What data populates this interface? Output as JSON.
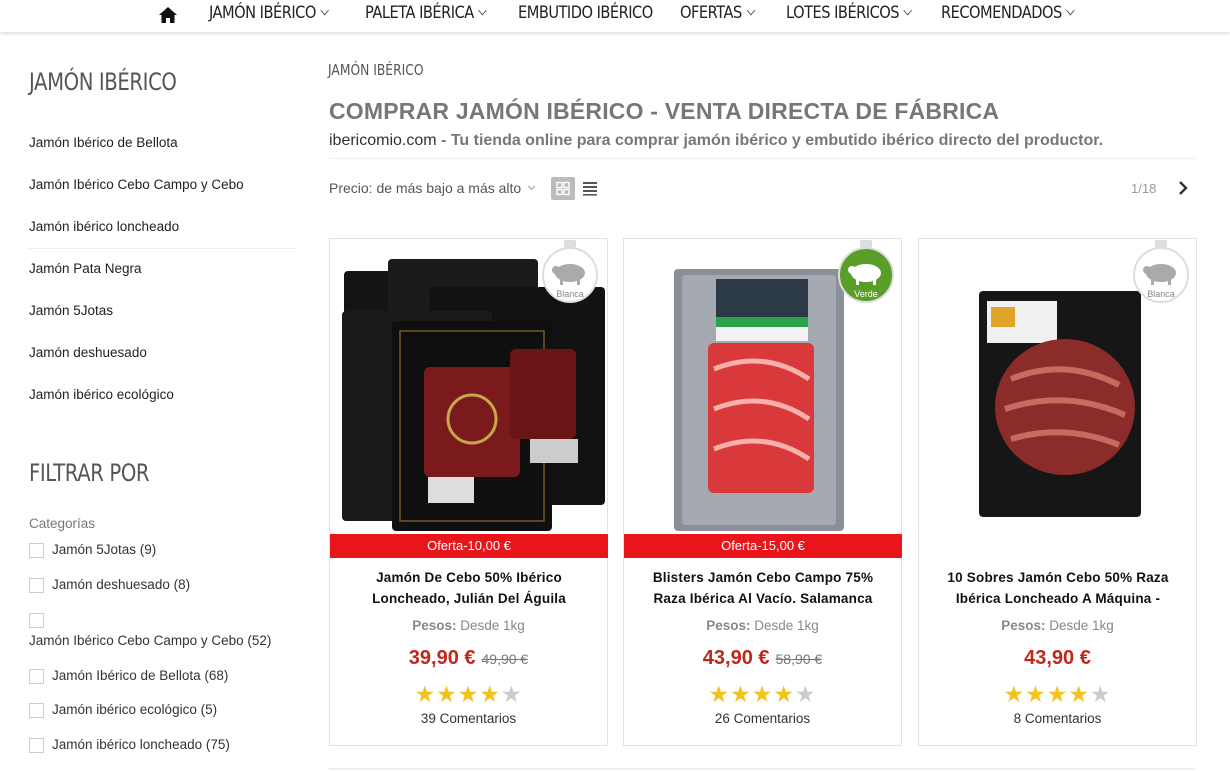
{
  "nav": {
    "items": [
      {
        "label": "JAMÓN IBÉRICO",
        "dropdown": true
      },
      {
        "label": "PALETA IBÉRICA",
        "dropdown": true
      },
      {
        "label": "EMBUTIDO IBÉRICO",
        "dropdown": false
      },
      {
        "label": "OFERTAS",
        "dropdown": true
      },
      {
        "label": "LOTES IBÉRICOS",
        "dropdown": true
      },
      {
        "label": "RECOMENDADOS",
        "dropdown": true
      }
    ]
  },
  "sidebar": {
    "title": "JAMÓN IBÉRICO",
    "links": [
      "Jamón Ibérico de Bellota",
      "Jamón Ibérico Cebo Campo y Cebo",
      "Jamón ibérico loncheado",
      "Jamón Pata Negra",
      "Jamón 5Jotas",
      "Jamón deshuesado",
      "Jamón ibérico ecológico"
    ],
    "filter_title": "FILTRAR POR",
    "categories_label": "Categorías",
    "filters": [
      "Jamón 5Jotas (9)",
      "Jamón deshuesado (8)",
      "Jamón Ibérico Cebo Campo y Cebo (52)",
      "Jamón Ibérico de Bellota (68)",
      "Jamón ibérico ecológico (5)",
      "Jamón ibérico loncheado (75)"
    ]
  },
  "main": {
    "breadcrumb": "JAMÓN IBÉRICO",
    "title": "COMPRAR JAMÓN IBÉRICO - VENTA DIRECTA DE FÁBRICA",
    "subtitle_site": "ibericomio.com",
    "subtitle_text": " - Tu tienda online para comprar jamón ibérico y embutido ibérico directo del productor.",
    "sort_label": "Precio: de más bajo a más alto",
    "pager": "1/18"
  },
  "products": [
    {
      "offer": "Oferta-10,00 €",
      "name": "Jamón De Cebo 50% Ibérico Loncheado, Julián Del Águila",
      "pesos_label": "Pesos:",
      "pesos_value": "Desde 1kg",
      "price": "39,90 €",
      "old_price": "49,90 €",
      "rating": 4,
      "comments": "39 Comentarios",
      "badge": "Blanca",
      "badge_color": "#ffffff",
      "badge_text_color": "#888888"
    },
    {
      "offer": "Oferta-15,00 €",
      "name": "Blisters Jamón Cebo Campo 75% Raza Ibérica Al Vacío. Salamanca",
      "pesos_label": "Pesos:",
      "pesos_value": "Desde 1kg",
      "price": "43,90 €",
      "old_price": "58,90 €",
      "rating": 4,
      "comments": "26 Comentarios",
      "badge": "Verde",
      "badge_color": "#5a9e2a",
      "badge_text_color": "#ffffff"
    },
    {
      "offer": "",
      "name": "10 Sobres Jamón Cebo 50% Raza Ibérica Loncheado A Máquina -",
      "pesos_label": "Pesos:",
      "pesos_value": "Desde 1kg",
      "price": "43,90 €",
      "old_price": "",
      "rating": 4,
      "comments": "8 Comentarios",
      "badge": "Blanca",
      "badge_color": "#ffffff",
      "badge_text_color": "#888888"
    }
  ],
  "colors": {
    "offer_bg": "#e8161b",
    "price": "#c0271e",
    "star": "#f2c31c"
  }
}
